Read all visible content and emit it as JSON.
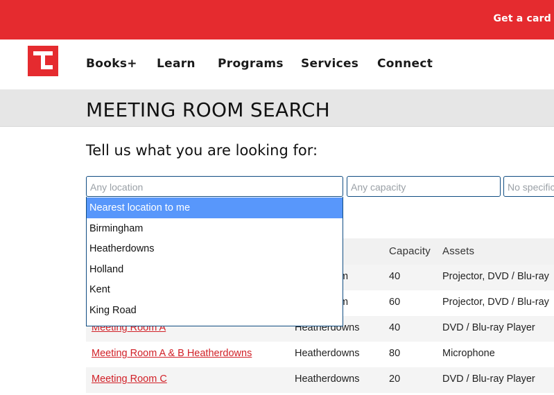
{
  "header": {
    "get_card": "Get a card",
    "nav": [
      "Books+",
      "Learn",
      "Programs",
      "Services",
      "Connect"
    ]
  },
  "page": {
    "title": "MEETING ROOM SEARCH",
    "subtitle": "Tell us what you are looking for:"
  },
  "filters": {
    "location_placeholder": "Any location",
    "capacity_placeholder": "Any capacity",
    "third_placeholder": "No specific"
  },
  "dropdown": {
    "options": [
      "Nearest location to me",
      "Birmingham",
      "Heatherdowns",
      "Holland",
      "Kent",
      "King Road"
    ],
    "highlighted": "Nearest location to me"
  },
  "table": {
    "headers": [
      "Capacity",
      "Assets"
    ],
    "rows": [
      {
        "name": "",
        "location_fragment": "m",
        "capacity": "40",
        "assets": "Projector, DVD / Blu-ray"
      },
      {
        "name": "",
        "location_fragment": "m",
        "capacity": "60",
        "assets": "Projector, DVD / Blu-ray"
      },
      {
        "name": "Meeting Room A",
        "location": "Heatherdowns",
        "capacity": "40",
        "assets": "DVD / Blu-ray Player"
      },
      {
        "name": "Meeting Room A & B Heatherdowns",
        "location": "Heatherdowns",
        "capacity": "80",
        "assets": "Microphone"
      },
      {
        "name": "Meeting Room C",
        "location": "Heatherdowns",
        "capacity": "20",
        "assets": "DVD / Blu-ray Player"
      }
    ]
  },
  "colors": {
    "brand_red": "#e52b2f",
    "link_red": "#d11f26",
    "highlight_blue": "#5897fb",
    "border_navy": "#0f4c81"
  }
}
